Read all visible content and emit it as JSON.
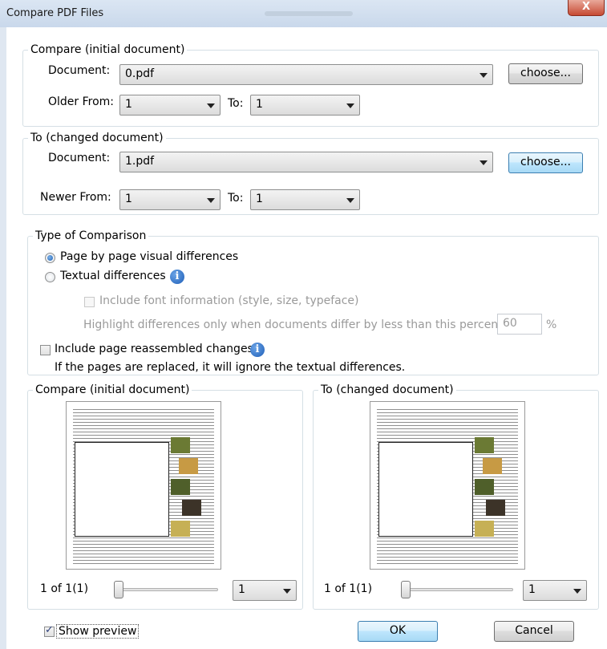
{
  "window": {
    "title": "Compare PDF Files",
    "close_glyph": "X"
  },
  "initial": {
    "legend": "Compare (initial document)",
    "document_label": "Document:",
    "document_value": "0.pdf",
    "choose_label": "choose...",
    "from_label": "Older From:",
    "from_value": "1",
    "to_label": "To:",
    "to_value": "1"
  },
  "changed": {
    "legend": "To (changed document)",
    "document_label": "Document:",
    "document_value": "1.pdf",
    "choose_label": "choose...",
    "from_label": "Newer From:",
    "from_value": "1",
    "to_label": "To:",
    "to_value": "1"
  },
  "comparison": {
    "legend": "Type of Comparison",
    "option_visual": "Page by page visual differences",
    "option_textual": "Textual differences",
    "include_font": "Include font information (style, size, typeface)",
    "highlight_text": "Highlight differences only when documents differ by less than this percentage:",
    "percentage_value": "60",
    "percent_sign": "%",
    "reassembled": "Include page reassembled changes",
    "reassembled_note": "If the pages are replaced, it will ignore the textual differences."
  },
  "preview_initial": {
    "legend": "Compare (initial document)",
    "page_count": "1 of 1(1)",
    "page_select": "1"
  },
  "preview_changed": {
    "legend": "To (changed document)",
    "page_count": "1 of 1(1)",
    "page_select": "1"
  },
  "footer": {
    "show_preview": "Show preview",
    "ok": "OK",
    "cancel": "Cancel"
  }
}
